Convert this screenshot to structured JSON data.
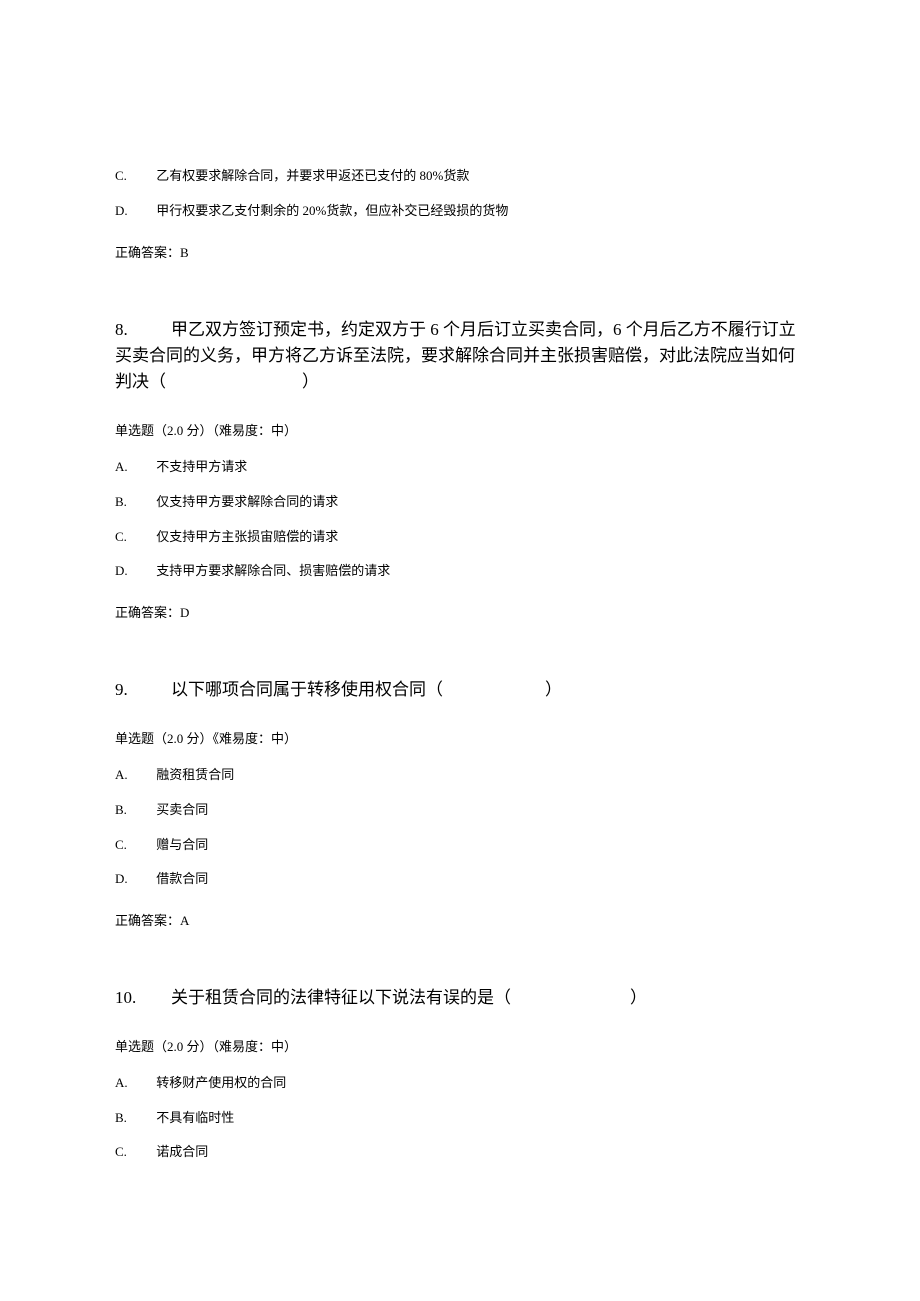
{
  "prev_question_tail": {
    "options": [
      {
        "letter": "C.",
        "text": "乙有权要求解除合同，并要求甲返还已支付的 80%货款"
      },
      {
        "letter": "D.",
        "text": "甲行权要求乙支付剩余的 20%货款，但应补交已经毁损的货物"
      }
    ],
    "answer": "正确答案：B"
  },
  "q8": {
    "number": "8.",
    "title": "甲乙双方签订预定书，约定双方于 6 个月后订立买卖合同，6 个月后乙方不履行订立买卖合同的义务，甲方将乙方诉至法院，要求解除合同并主张损害赔偿，对此法院应当如何判决（　　　　　　　　）",
    "meta": "单选题（2.0 分）（难易度：中）",
    "options": [
      {
        "letter": "A.",
        "text": "不支持甲方请求"
      },
      {
        "letter": "B.",
        "text": "仅支持甲方要求解除合同的请求"
      },
      {
        "letter": "C.",
        "text": "仅支持甲方主张损宙赔偿的请求"
      },
      {
        "letter": "D.",
        "text": "支持甲方要求解除合同、损害赔偿的请求"
      }
    ],
    "answer": "正确答案：D"
  },
  "q9": {
    "number": "9.",
    "title": "以下哪项合同属于转移使用权合同（　　　　　　）",
    "meta": "单选题（2.0 分）《难易度：中）",
    "options": [
      {
        "letter": "A.",
        "text": "融资租赁合同"
      },
      {
        "letter": "B.",
        "text": "买卖合同"
      },
      {
        "letter": "C.",
        "text": "赠与合同"
      },
      {
        "letter": "D.",
        "text": "借款合同"
      }
    ],
    "answer": "正确答案：A"
  },
  "q10": {
    "number": "10.",
    "title": "关于租赁合同的法律特征以下说法有误的是（　　　　　　　）",
    "meta": "单选题（2.0 分）（难易度：中）",
    "options": [
      {
        "letter": "A.",
        "text": "转移财产使用权的合同"
      },
      {
        "letter": "B.",
        "text": "不具有临时性"
      },
      {
        "letter": "C.",
        "text": "诺成合同"
      }
    ]
  }
}
